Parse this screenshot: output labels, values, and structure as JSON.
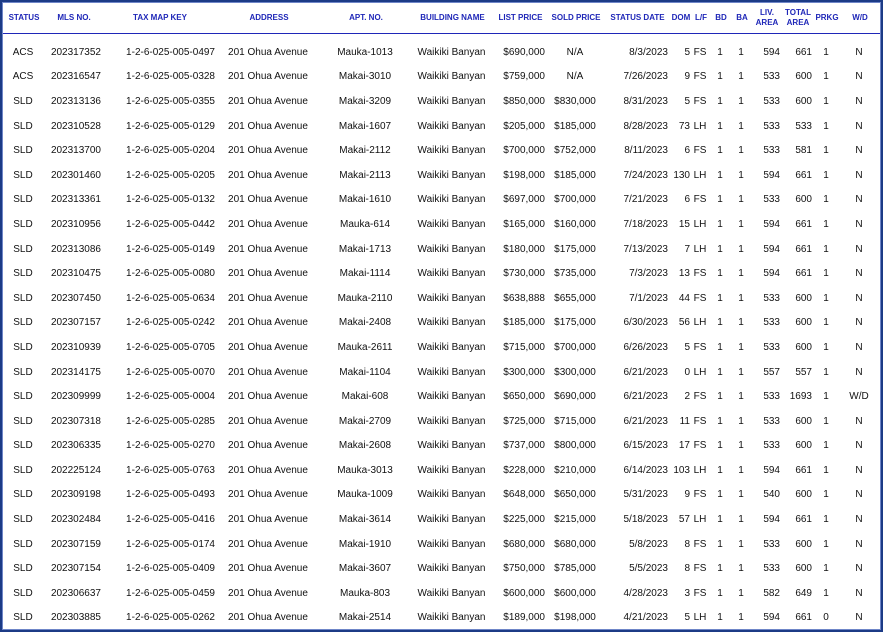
{
  "columns": [
    "STATUS",
    "MLS NO.",
    "TAX MAP KEY",
    "ADDRESS",
    "APT. NO.",
    "BUILDING NAME",
    "LIST PRICE",
    "SOLD PRICE",
    "STATUS DATE",
    "DOM",
    "L/F",
    "BD",
    "BA",
    "LIV. AREA",
    "TOTAL AREA",
    "PRKG",
    "W/D"
  ],
  "rows": [
    [
      "ACS",
      "202317352",
      "1-2-6-025-005-0497",
      "201 Ohua Avenue",
      "Mauka-1013",
      "Waikiki Banyan",
      "$690,000",
      "N/A",
      "8/3/2023",
      "5",
      "FS",
      "1",
      "1",
      "594",
      "661",
      "1",
      "N"
    ],
    [
      "ACS",
      "202316547",
      "1-2-6-025-005-0328",
      "201 Ohua Avenue",
      "Makai-3010",
      "Waikiki Banyan",
      "$759,000",
      "N/A",
      "7/26/2023",
      "9",
      "FS",
      "1",
      "1",
      "533",
      "600",
      "1",
      "N"
    ],
    [
      "SLD",
      "202313136",
      "1-2-6-025-005-0355",
      "201 Ohua Avenue",
      "Makai-3209",
      "Waikiki Banyan",
      "$850,000",
      "$830,000",
      "8/31/2023",
      "5",
      "FS",
      "1",
      "1",
      "533",
      "600",
      "1",
      "N"
    ],
    [
      "SLD",
      "202310528",
      "1-2-6-025-005-0129",
      "201 Ohua Avenue",
      "Makai-1607",
      "Waikiki Banyan",
      "$205,000",
      "$185,000",
      "8/28/2023",
      "73",
      "LH",
      "1",
      "1",
      "533",
      "533",
      "1",
      "N"
    ],
    [
      "SLD",
      "202313700",
      "1-2-6-025-005-0204",
      "201 Ohua Avenue",
      "Makai-2112",
      "Waikiki Banyan",
      "$700,000",
      "$752,000",
      "8/11/2023",
      "6",
      "FS",
      "1",
      "1",
      "533",
      "581",
      "1",
      "N"
    ],
    [
      "SLD",
      "202301460",
      "1-2-6-025-005-0205",
      "201 Ohua Avenue",
      "Makai-2113",
      "Waikiki Banyan",
      "$198,000",
      "$185,000",
      "7/24/2023",
      "130",
      "LH",
      "1",
      "1",
      "594",
      "661",
      "1",
      "N"
    ],
    [
      "SLD",
      "202313361",
      "1-2-6-025-005-0132",
      "201 Ohua Avenue",
      "Makai-1610",
      "Waikiki Banyan",
      "$697,000",
      "$700,000",
      "7/21/2023",
      "6",
      "FS",
      "1",
      "1",
      "533",
      "600",
      "1",
      "N"
    ],
    [
      "SLD",
      "202310956",
      "1-2-6-025-005-0442",
      "201 Ohua Avenue",
      "Mauka-614",
      "Waikiki Banyan",
      "$165,000",
      "$160,000",
      "7/18/2023",
      "15",
      "LH",
      "1",
      "1",
      "594",
      "661",
      "1",
      "N"
    ],
    [
      "SLD",
      "202313086",
      "1-2-6-025-005-0149",
      "201 Ohua Avenue",
      "Makai-1713",
      "Waikiki Banyan",
      "$180,000",
      "$175,000",
      "7/13/2023",
      "7",
      "LH",
      "1",
      "1",
      "594",
      "661",
      "1",
      "N"
    ],
    [
      "SLD",
      "202310475",
      "1-2-6-025-005-0080",
      "201 Ohua Avenue",
      "Makai-1114",
      "Waikiki Banyan",
      "$730,000",
      "$735,000",
      "7/3/2023",
      "13",
      "FS",
      "1",
      "1",
      "594",
      "661",
      "1",
      "N"
    ],
    [
      "SLD",
      "202307450",
      "1-2-6-025-005-0634",
      "201 Ohua Avenue",
      "Mauka-2110",
      "Waikiki Banyan",
      "$638,888",
      "$655,000",
      "7/1/2023",
      "44",
      "FS",
      "1",
      "1",
      "533",
      "600",
      "1",
      "N"
    ],
    [
      "SLD",
      "202307157",
      "1-2-6-025-005-0242",
      "201 Ohua Avenue",
      "Makai-2408",
      "Waikiki Banyan",
      "$185,000",
      "$175,000",
      "6/30/2023",
      "56",
      "LH",
      "1",
      "1",
      "533",
      "600",
      "1",
      "N"
    ],
    [
      "SLD",
      "202310939",
      "1-2-6-025-005-0705",
      "201 Ohua Avenue",
      "Mauka-2611",
      "Waikiki Banyan",
      "$715,000",
      "$700,000",
      "6/26/2023",
      "5",
      "FS",
      "1",
      "1",
      "533",
      "600",
      "1",
      "N"
    ],
    [
      "SLD",
      "202314175",
      "1-2-6-025-005-0070",
      "201 Ohua Avenue",
      "Makai-1104",
      "Waikiki Banyan",
      "$300,000",
      "$300,000",
      "6/21/2023",
      "0",
      "LH",
      "1",
      "1",
      "557",
      "557",
      "1",
      "N"
    ],
    [
      "SLD",
      "202309999",
      "1-2-6-025-005-0004",
      "201 Ohua Avenue",
      "Makai-608",
      "Waikiki Banyan",
      "$650,000",
      "$690,000",
      "6/21/2023",
      "2",
      "FS",
      "1",
      "1",
      "533",
      "1693",
      "1",
      "W/D"
    ],
    [
      "SLD",
      "202307318",
      "1-2-6-025-005-0285",
      "201 Ohua Avenue",
      "Makai-2709",
      "Waikiki Banyan",
      "$725,000",
      "$715,000",
      "6/21/2023",
      "11",
      "FS",
      "1",
      "1",
      "533",
      "600",
      "1",
      "N"
    ],
    [
      "SLD",
      "202306335",
      "1-2-6-025-005-0270",
      "201 Ohua Avenue",
      "Makai-2608",
      "Waikiki Banyan",
      "$737,000",
      "$800,000",
      "6/15/2023",
      "17",
      "FS",
      "1",
      "1",
      "533",
      "600",
      "1",
      "N"
    ],
    [
      "SLD",
      "202225124",
      "1-2-6-025-005-0763",
      "201 Ohua Avenue",
      "Mauka-3013",
      "Waikiki Banyan",
      "$228,000",
      "$210,000",
      "6/14/2023",
      "103",
      "LH",
      "1",
      "1",
      "594",
      "661",
      "1",
      "N"
    ],
    [
      "SLD",
      "202309198",
      "1-2-6-025-005-0493",
      "201 Ohua Avenue",
      "Mauka-1009",
      "Waikiki Banyan",
      "$648,000",
      "$650,000",
      "5/31/2023",
      "9",
      "FS",
      "1",
      "1",
      "540",
      "600",
      "1",
      "N"
    ],
    [
      "SLD",
      "202302484",
      "1-2-6-025-005-0416",
      "201 Ohua Avenue",
      "Makai-3614",
      "Waikiki Banyan",
      "$225,000",
      "$215,000",
      "5/18/2023",
      "57",
      "LH",
      "1",
      "1",
      "594",
      "661",
      "1",
      "N"
    ],
    [
      "SLD",
      "202307159",
      "1-2-6-025-005-0174",
      "201 Ohua Avenue",
      "Makai-1910",
      "Waikiki Banyan",
      "$680,000",
      "$680,000",
      "5/8/2023",
      "8",
      "FS",
      "1",
      "1",
      "533",
      "600",
      "1",
      "N"
    ],
    [
      "SLD",
      "202307154",
      "1-2-6-025-005-0409",
      "201 Ohua Avenue",
      "Makai-3607",
      "Waikiki Banyan",
      "$750,000",
      "$785,000",
      "5/5/2023",
      "8",
      "FS",
      "1",
      "1",
      "533",
      "600",
      "1",
      "N"
    ],
    [
      "SLD",
      "202306637",
      "1-2-6-025-005-0459",
      "201 Ohua Avenue",
      "Mauka-803",
      "Waikiki Banyan",
      "$600,000",
      "$600,000",
      "4/28/2023",
      "3",
      "FS",
      "1",
      "1",
      "582",
      "649",
      "1",
      "N"
    ],
    [
      "SLD",
      "202303885",
      "1-2-6-025-005-0262",
      "201 Ohua Avenue",
      "Makai-2514",
      "Waikiki Banyan",
      "$189,000",
      "$198,000",
      "4/21/2023",
      "5",
      "LH",
      "1",
      "1",
      "594",
      "661",
      "0",
      "N"
    ]
  ],
  "colors": {
    "frame": "#1c3b86",
    "header_text": "#1f27b8"
  }
}
